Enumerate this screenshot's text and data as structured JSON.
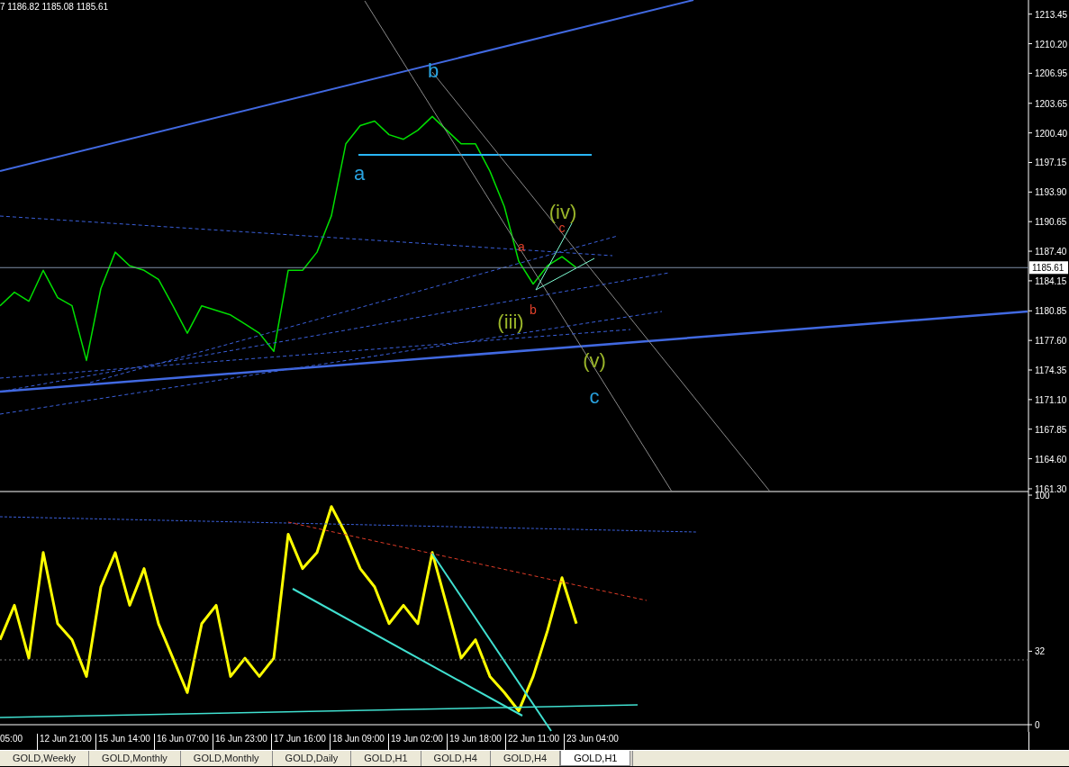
{
  "header": {
    "readout": "7 1186.82 1185.08 1185.61"
  },
  "price_pane": {
    "chart_data": {
      "type": "line",
      "ylim": [
        1160.9,
        1215.0
      ],
      "yticks": [
        {
          "value": 1213.45,
          "label": "1213.45"
        },
        {
          "value": 1210.2,
          "label": "1210.20"
        },
        {
          "value": 1206.95,
          "label": "1206.95"
        },
        {
          "value": 1203.65,
          "label": "1203.65"
        },
        {
          "value": 1200.4,
          "label": "1200.40"
        },
        {
          "value": 1197.15,
          "label": "1197.15"
        },
        {
          "value": 1193.9,
          "label": "1193.90"
        },
        {
          "value": 1190.65,
          "label": "1190.65"
        },
        {
          "value": 1187.4,
          "label": "1187.40"
        },
        {
          "value": 1184.15,
          "label": "1184.15"
        },
        {
          "value": 1180.85,
          "label": "1180.85"
        },
        {
          "value": 1177.6,
          "label": "1177.60"
        },
        {
          "value": 1174.35,
          "label": "1174.35"
        },
        {
          "value": 1171.1,
          "label": "1171.10"
        },
        {
          "value": 1167.85,
          "label": "1167.85"
        },
        {
          "value": 1164.6,
          "label": "1164.60"
        },
        {
          "value": 1161.3,
          "label": "1161.30"
        }
      ],
      "series": [
        {
          "color": "#00e000",
          "values": [
            1181.4,
            1182.9,
            1181.9,
            1185.3,
            1182.3,
            1181.4,
            1175.4,
            1183.3,
            1187.3,
            1185.8,
            1185.3,
            1184.3,
            1181.4,
            1178.4,
            1181.4,
            1180.9,
            1180.4,
            1179.4,
            1178.4,
            1176.4,
            1185.3,
            1185.3,
            1187.3,
            1191.3,
            1199.2,
            1201.2,
            1201.7,
            1200.2,
            1199.7,
            1200.7,
            1202.2,
            1200.7,
            1199.2,
            1199.2,
            1196.2,
            1192.3,
            1186.3,
            1183.8,
            1185.8,
            1186.8,
            1185.6
          ]
        }
      ]
    },
    "current_price": {
      "label": "1185.61"
    },
    "wave_labels": [
      {
        "text": "b",
        "color": "#29a3e0"
      },
      {
        "text": "a",
        "color": "#29a3e0"
      },
      {
        "text": "(iv)",
        "color": "#9ab52a"
      },
      {
        "text": "c",
        "color": "#e0402a"
      },
      {
        "text": "a",
        "color": "#e0402a"
      },
      {
        "text": "b",
        "color": "#e0402a"
      },
      {
        "text": "(iii)",
        "color": "#9ab52a"
      },
      {
        "text": "(v)",
        "color": "#9ab52a"
      },
      {
        "text": "c",
        "color": "#29a3e0"
      }
    ]
  },
  "oscillator_pane": {
    "chart_data": {
      "type": "line",
      "ylim": [
        0,
        100
      ],
      "yticks": [
        {
          "value": 100,
          "label": "100"
        },
        {
          "value": 32,
          "label": "32"
        },
        {
          "value": 0,
          "label": "0"
        }
      ],
      "series": [
        {
          "color": "#ffff00",
          "values": [
            37,
            52,
            29,
            75,
            44,
            37,
            21,
            60,
            75,
            52,
            68,
            44,
            29,
            14,
            44,
            52,
            21,
            29,
            21,
            29,
            83,
            68,
            75,
            95,
            83,
            68,
            60,
            44,
            52,
            44,
            75,
            52,
            29,
            37,
            21,
            14,
            6,
            21,
            41,
            64,
            44
          ]
        }
      ]
    }
  },
  "time_axis": {
    "labels": [
      "05:00",
      "12 Jun 21:00",
      "15 Jun 14:00",
      "16 Jun 07:00",
      "16 Jun 23:00",
      "17 Jun 16:00",
      "18 Jun 09:00",
      "19 Jun 02:00",
      "19 Jun 18:00",
      "22 Jun 11:00",
      "23 Jun 04:00"
    ]
  },
  "tabs": [
    {
      "label": "GOLD,Weekly",
      "selected": false
    },
    {
      "label": "GOLD,Monthly",
      "selected": false
    },
    {
      "label": "GOLD,Monthly",
      "selected": false
    },
    {
      "label": "GOLD,Daily",
      "selected": false
    },
    {
      "label": "GOLD,H1",
      "selected": false
    },
    {
      "label": "GOLD,H4",
      "selected": false
    },
    {
      "label": "GOLD,H4",
      "selected": false
    },
    {
      "label": "GOLD,H1",
      "selected": true
    }
  ]
}
